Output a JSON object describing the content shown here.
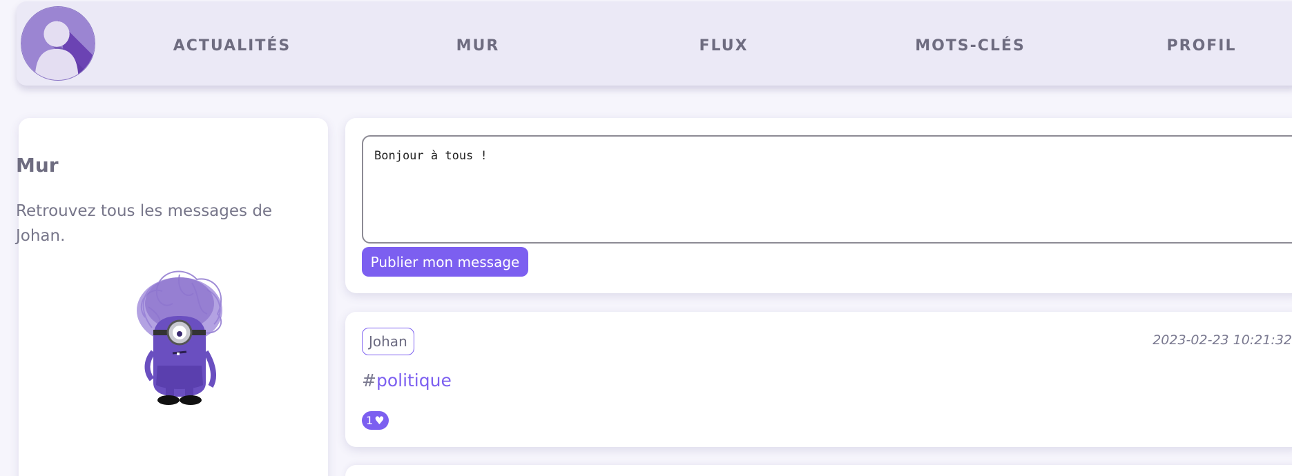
{
  "header": {
    "avatar_icon": "user-avatar-icon",
    "nav": [
      {
        "label": "ACTUALITÉS"
      },
      {
        "label": "MUR"
      },
      {
        "label": "FLUX"
      },
      {
        "label": "MOTS-CLÉS"
      },
      {
        "label": "PROFIL"
      }
    ]
  },
  "sidebar": {
    "title": "Mur",
    "description": "Retrouvez tous les messages de Johan.",
    "image_icon": "purple-minion-illustration"
  },
  "composer": {
    "value": "Bonjour à tous !",
    "submit_label": "Publier mon message"
  },
  "posts": [
    {
      "author": "Johan",
      "date": "2023-02-23 10:21:32",
      "hashtag_prefix": "#",
      "hashtag": "politique",
      "likes": "1",
      "like_icon": "♥"
    }
  ],
  "colors": {
    "accent": "#7c5ff0",
    "header_bg": "#ebe9f6",
    "page_bg": "#f6f5fc",
    "text": "#6e6c80"
  }
}
